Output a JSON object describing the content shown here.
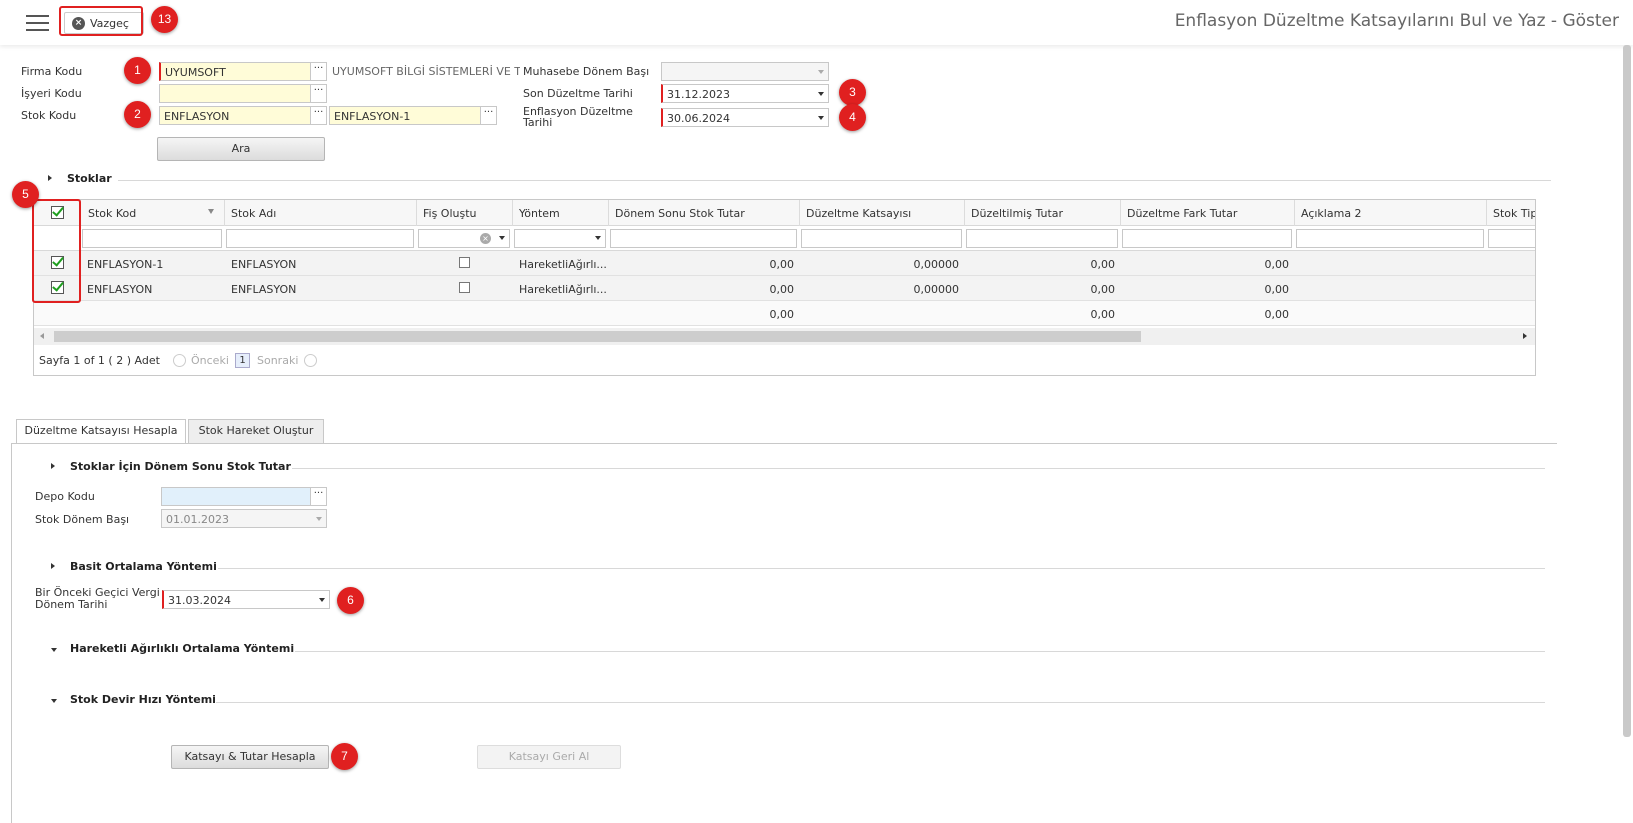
{
  "topbar": {
    "cancel_label": "Vazgeç",
    "page_title": "Enflasyon Düzeltme Katsayılarını Bul ve Yaz - Göster"
  },
  "callouts": [
    "1",
    "2",
    "3",
    "4",
    "5",
    "6",
    "7",
    "13"
  ],
  "form": {
    "firma_kodu_label": "Firma Kodu",
    "firma_kodu_value": "UYUMSOFT",
    "firma_adi": "UYUMSOFT BİLGİ SİSTEMLERİ VE T",
    "isyeri_kodu_label": "İşyeri Kodu",
    "isyeri_kodu_value": "",
    "stok_kodu_label": "Stok Kodu",
    "stok_kodu_value": "ENFLASYON",
    "stok_kodu_value2": "ENFLASYON-1",
    "muhasebe_donem_label": "Muhasebe Dönem Başı",
    "muhasebe_donem_value": "",
    "son_duzeltme_label": "Son Düzeltme Tarihi",
    "son_duzeltme_value": "31.12.2023",
    "enf_duzeltme_label_1": "Enflasyon Düzeltme",
    "enf_duzeltme_label_2": "Tarihi",
    "enf_duzeltme_value": "30.06.2024",
    "ara_label": "Ara"
  },
  "stoklar_section": "Stoklar",
  "grid": {
    "columns": [
      "Stok Kod",
      "Stok Adı",
      "Fiş Oluştu",
      "Yöntem",
      "Dönem Sonu Stok Tutar",
      "Düzeltme Katsayısı",
      "Düzeltilmiş Tutar",
      "Düzeltme Fark Tutar",
      "Açıklama 2",
      "Stok Tip"
    ],
    "rows": [
      {
        "stok_kod": "ENFLASYON-1",
        "stok_adi": "ENFLASYON",
        "yontem": "HareketliAğırlı...",
        "donem_sonu": "0,00",
        "katsayi": "0,00000",
        "duzeltilmis": "0,00",
        "fark": "0,00"
      },
      {
        "stok_kod": "ENFLASYON",
        "stok_adi": "ENFLASYON",
        "yontem": "HareketliAğırlı...",
        "donem_sonu": "0,00",
        "katsayi": "0,00000",
        "duzeltilmis": "0,00",
        "fark": "0,00"
      }
    ],
    "totals": {
      "donem_sonu": "0,00",
      "duzeltilmis": "0,00",
      "fark": "0,00"
    },
    "pager": {
      "info": "Sayfa 1 of 1 ( 2 ) Adet",
      "prev": "Önceki",
      "page": "1",
      "next": "Sonraki"
    }
  },
  "tabs": [
    "Düzeltme Katsayısı Hesapla",
    "Stok Hareket Oluştur"
  ],
  "tab_panel": {
    "section1": "Stoklar İçin Dönem Sonu Stok Tutar",
    "depo_kodu_label": "Depo Kodu",
    "depo_kodu_value": "",
    "stok_donem_label": "Stok Dönem Başı",
    "stok_donem_value": "01.01.2023",
    "section2": "Basit Ortalama Yöntemi",
    "onceki_label_1": "Bir Önceki Geçici Vergi",
    "onceki_label_2": "Dönem Tarihi",
    "onceki_value": "31.03.2024",
    "section3": "Hareketli Ağırlıklı Ortalama Yöntemi",
    "section4": "Stok Devir Hızı Yöntemi",
    "hesapla_label": "Katsayı & Tutar Hesapla",
    "geri_al_label": "Katsayı Geri Al"
  },
  "colors": {
    "callout": "#e02020",
    "required_bg": "#fffcd8",
    "check": "#1e9e1e"
  }
}
